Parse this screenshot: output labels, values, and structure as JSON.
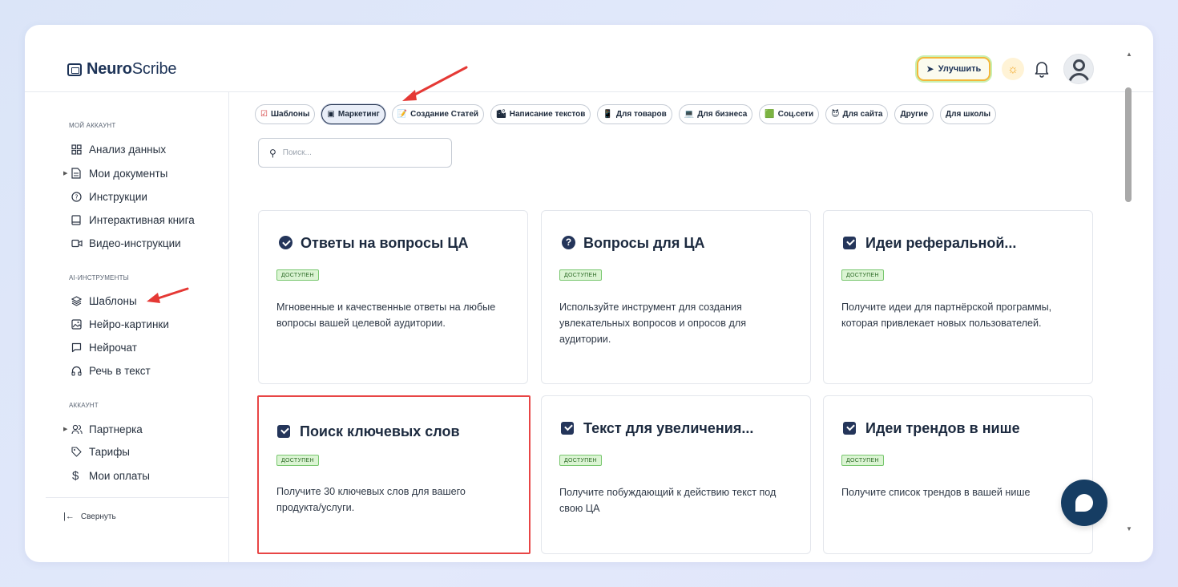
{
  "header": {
    "logo_bold": "Neuro",
    "logo_rest": "Scribe",
    "upgrade_label": "Улучшить"
  },
  "sidebar": {
    "section_account": "МОЙ АККАУНТ",
    "items_account": [
      {
        "label": "Анализ данных",
        "icon": "grid-icon"
      },
      {
        "label": "Мои документы",
        "icon": "document-icon",
        "expandable": true
      },
      {
        "label": "Инструкции",
        "icon": "help-circle-icon"
      },
      {
        "label": "Интерактивная книга",
        "icon": "book-icon"
      },
      {
        "label": "Видео-инструкции",
        "icon": "video-icon"
      }
    ],
    "section_ai": "AI-ИНСТРУМЕНТЫ",
    "items_ai": [
      {
        "label": "Шаблоны",
        "icon": "layers-icon",
        "active": true
      },
      {
        "label": "Нейро-картинки",
        "icon": "image-icon"
      },
      {
        "label": "Нейрочат",
        "icon": "chat-icon"
      },
      {
        "label": "Речь в текст",
        "icon": "headphones-icon"
      }
    ],
    "section_acc": "АККАУНТ",
    "items_acc": [
      {
        "label": "Партнерка",
        "icon": "users-icon",
        "expandable": true
      },
      {
        "label": "Тарифы",
        "icon": "tag-icon"
      },
      {
        "label": "Мои оплаты",
        "icon": "dollar-icon"
      }
    ],
    "collapse_label": "Свернуть"
  },
  "chips": [
    {
      "label": "Шаблоны",
      "emoji": "☑"
    },
    {
      "label": "Маркетинг",
      "emoji": "▣",
      "selected": true
    },
    {
      "label": "Создание Статей",
      "emoji": "📝"
    },
    {
      "label": "Написание текстов",
      "emoji": "🏙"
    },
    {
      "label": "Для товаров",
      "emoji": "📱"
    },
    {
      "label": "Для бизнеса",
      "emoji": "💻"
    },
    {
      "label": "Соц.сети",
      "emoji": "🟩"
    },
    {
      "label": "Для сайта",
      "emoji": "😈"
    },
    {
      "label": "Другие",
      "emoji": ""
    },
    {
      "label": "Для школы",
      "emoji": ""
    }
  ],
  "search": {
    "placeholder": "Поиск..."
  },
  "cards": [
    {
      "title": "Ответы на вопросы ЦА",
      "badge": "доступен",
      "desc": "Мгновенные и качественные ответы на любые вопросы вашей целевой аудитории.",
      "icon": "circle-check-icon"
    },
    {
      "title": "Вопросы для ЦА",
      "badge": "доступен",
      "desc": "Используйте инструмент для создания увлекательных вопросов и опросов для аудитории.",
      "icon": "question-icon"
    },
    {
      "title": "Идеи реферальной...",
      "badge": "доступен",
      "desc": "Получите идеи для партнёрской программы, которая привлекает новых пользователей.",
      "icon": "checkbox-icon"
    },
    {
      "title": "Поиск ключевых слов",
      "badge": "доступен",
      "desc": "Получите 30 ключевых слов для вашего продукта/услуги.",
      "icon": "checkbox-icon",
      "highlighted": true
    },
    {
      "title": "Текст для увеличения...",
      "badge": "доступен",
      "desc": "Получите побуждающий к действию текст под свою ЦА",
      "icon": "checkbox-icon"
    },
    {
      "title": "Идеи трендов в нише",
      "badge": "доступен",
      "desc": "Получите список трендов в вашей нише",
      "icon": "checkbox-icon"
    }
  ],
  "colors": {
    "primary": "#24355a",
    "badge_bg": "#dbf4d3",
    "highlight": "#e84545",
    "arrow": "#e53935",
    "fab": "#163d63"
  }
}
